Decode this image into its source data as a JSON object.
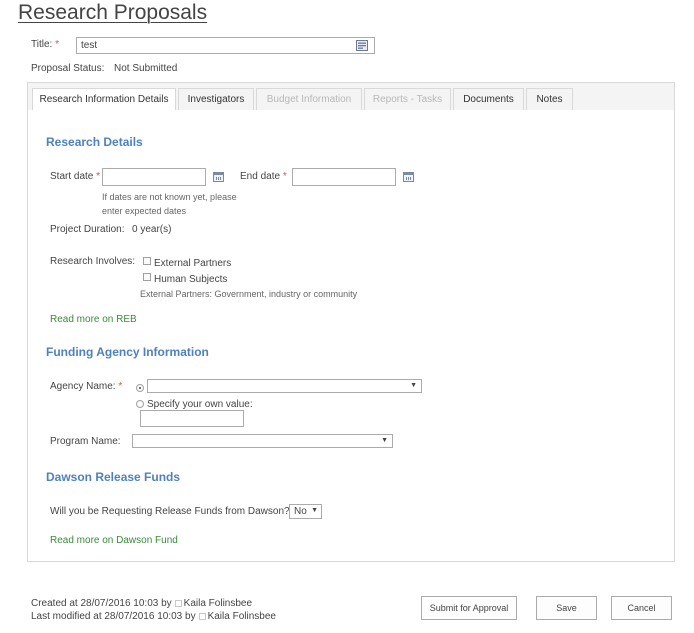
{
  "page": {
    "title": "Research Proposals"
  },
  "form": {
    "title_label": "Title:",
    "required_mark": "*",
    "title_value": "test",
    "status_label": "Proposal Status:",
    "status_value": "Not Submitted"
  },
  "tabs": [
    {
      "label": "Research Information Details",
      "state": "active"
    },
    {
      "label": "Investigators",
      "state": "enabled"
    },
    {
      "label": "Budget Information",
      "state": "disabled"
    },
    {
      "label": "Reports - Tasks",
      "state": "disabled"
    },
    {
      "label": "Documents",
      "state": "enabled"
    },
    {
      "label": "Notes",
      "state": "enabled"
    }
  ],
  "research": {
    "heading": "Research Details",
    "start_date_label": "Start date",
    "start_date_value": "",
    "end_date_label": "End date",
    "end_date_value": "",
    "date_hint_line1": "If dates are not known yet, please",
    "date_hint_line2": "enter expected dates",
    "duration_label": "Project Duration:",
    "duration_value": "0 year(s)",
    "involves_label": "Research Involves:",
    "involves_options": [
      {
        "label": "External Partners",
        "checked": false
      },
      {
        "label": "Human Subjects",
        "checked": false
      }
    ],
    "involves_note": "External Partners: Government, industry or community",
    "reb_link": "Read more on REB"
  },
  "funding": {
    "heading": "Funding Agency Information",
    "agency_label": "Agency Name:",
    "agency_value": "",
    "specify_label": "Specify your own value:",
    "specify_value": "",
    "program_label": "Program Name:",
    "program_value": ""
  },
  "release": {
    "heading": "Dawson Release Funds",
    "question": "Will you be Requesting Release Funds from Dawson?",
    "answer": "No",
    "link": "Read more on Dawson Fund"
  },
  "footer": {
    "created_text": "Created at 28/07/2016 10:03 by",
    "created_user": "Kaila Folinsbee",
    "modified_text": "Last modified at 28/07/2016 10:03 by",
    "modified_user": "Kaila Folinsbee"
  },
  "buttons": {
    "submit": "Submit for Approval",
    "save": "Save",
    "cancel": "Cancel"
  },
  "icons": {
    "calendar": "calendar-icon",
    "dropdown": "chevron-down-icon",
    "title_field": "field-menu-icon",
    "user": "user-presence-icon"
  },
  "colors": {
    "section_heading": "#4f81bd",
    "link_green": "#3a8a3a",
    "required": "#d9534f",
    "disabled_tab": "#b8b8b8"
  }
}
